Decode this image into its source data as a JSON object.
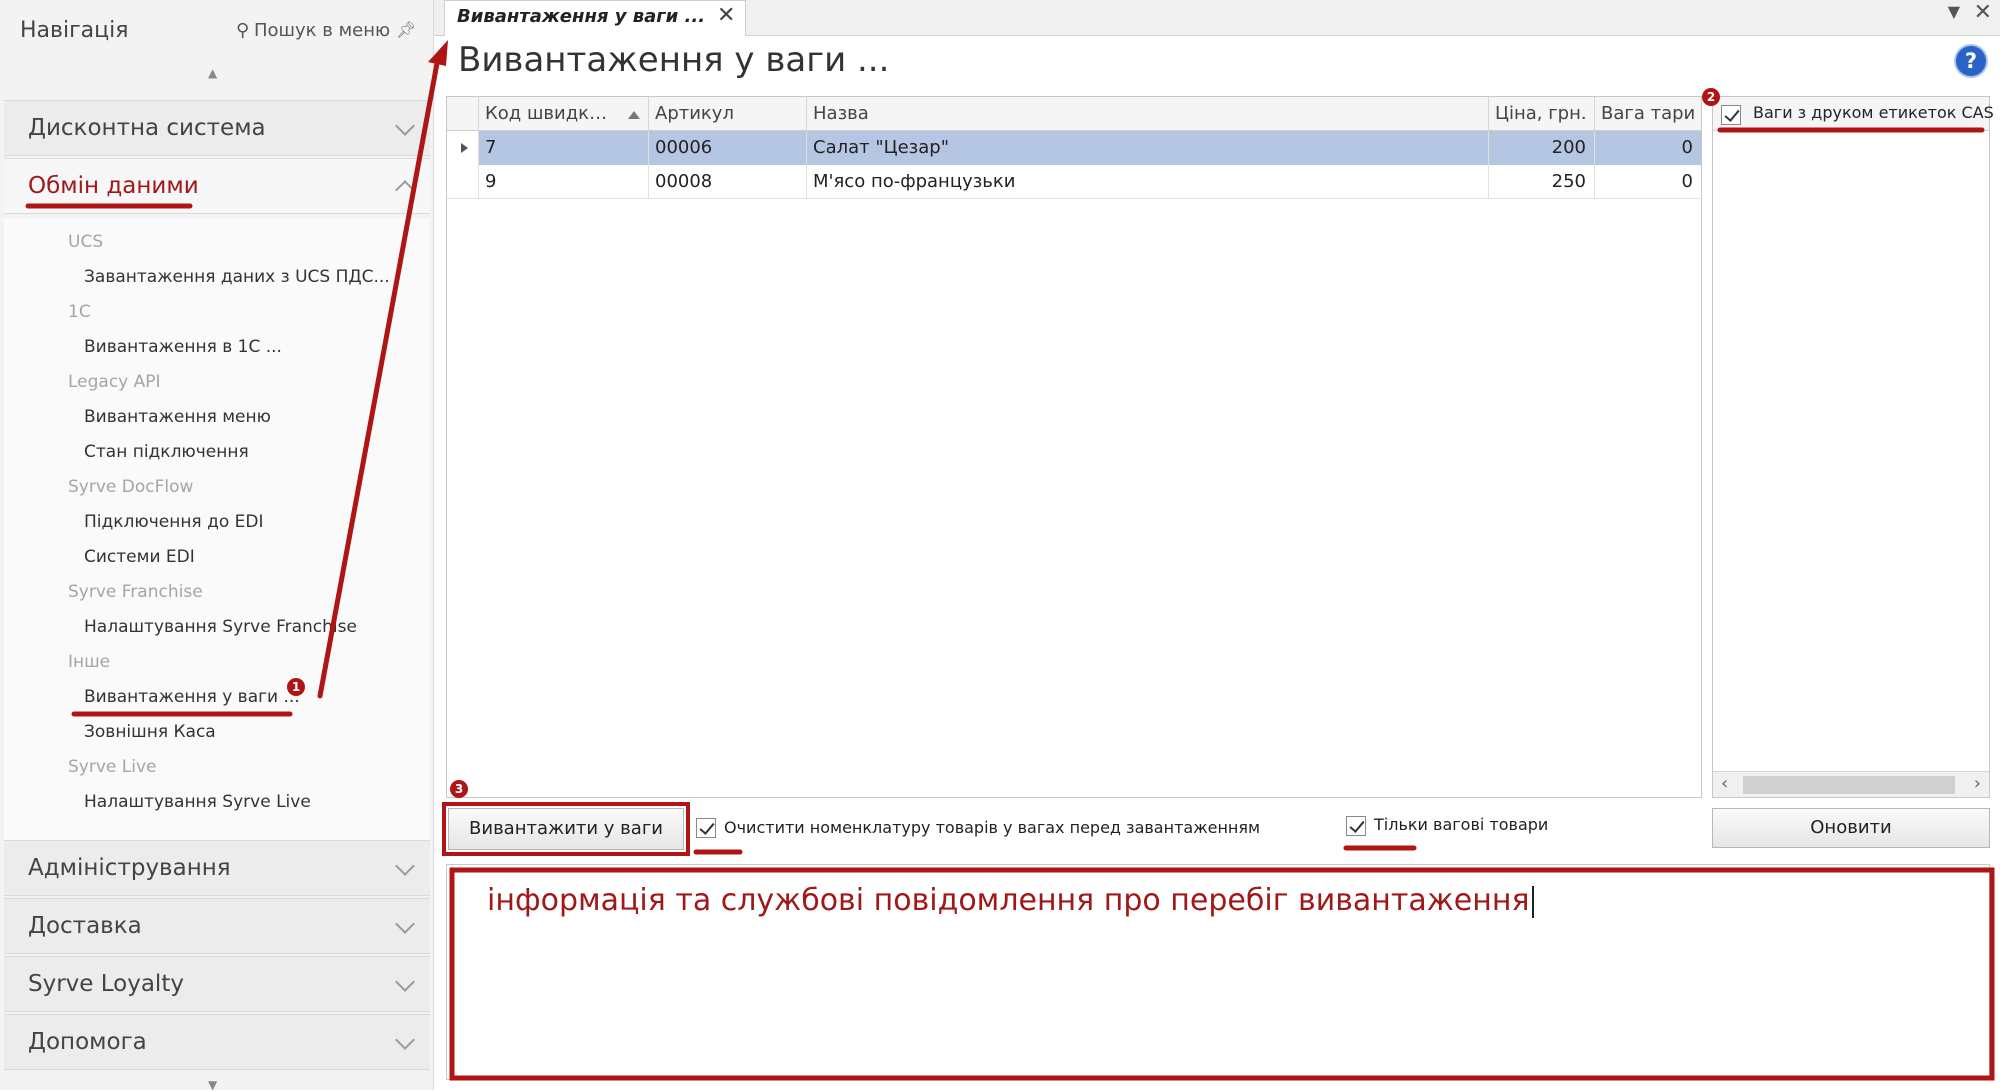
{
  "nav": {
    "title": "Навігація",
    "search_label": "Пошук в меню",
    "sections_top": [
      {
        "label": "Дисконтна система"
      },
      {
        "label": "Обмін даними"
      }
    ],
    "exchange_items": [
      {
        "kind": "group",
        "label": "UCS"
      },
      {
        "kind": "item",
        "label": "Завантаження даних з UCS ПДС..."
      },
      {
        "kind": "group",
        "label": "1С"
      },
      {
        "kind": "item",
        "label": "Вивантаження в 1С ..."
      },
      {
        "kind": "group",
        "label": "Legacy API"
      },
      {
        "kind": "item",
        "label": "Вивантаження меню"
      },
      {
        "kind": "item",
        "label": "Стан підключення"
      },
      {
        "kind": "group",
        "label": "Syrve DocFlow"
      },
      {
        "kind": "item",
        "label": "Підключення до EDI"
      },
      {
        "kind": "item",
        "label": "Системи EDI"
      },
      {
        "kind": "group",
        "label": "Syrve Franchise"
      },
      {
        "kind": "item",
        "label": "Налаштування Syrve Franchise"
      },
      {
        "kind": "group",
        "label": "Інше"
      },
      {
        "kind": "item",
        "label": "Вивантаження у ваги ..."
      },
      {
        "kind": "item",
        "label": "Зовнішня Каса"
      },
      {
        "kind": "group",
        "label": "Syrve Live"
      },
      {
        "kind": "item",
        "label": "Налаштування Syrve Live"
      }
    ],
    "sections_bottom": [
      {
        "label": "Адміністрування"
      },
      {
        "label": "Доставка"
      },
      {
        "label": "Syrve Loyalty"
      },
      {
        "label": "Допомога"
      }
    ]
  },
  "tab": {
    "label": "Вивантаження у ваги ..."
  },
  "page": {
    "title": "Вивантаження у ваги ..."
  },
  "grid": {
    "columns": [
      "Код швидкого набору",
      "Артикул",
      "Назва",
      "Ціна, грн.",
      "Вага тари"
    ],
    "rows": [
      {
        "code": "7",
        "article": "00006",
        "name": "Салат \"Цезар\"",
        "price": "200",
        "tare": "0",
        "selected": true
      },
      {
        "code": "9",
        "article": "00008",
        "name": "М'ясо по-французьки",
        "price": "250",
        "tare": "0",
        "selected": false
      }
    ]
  },
  "scales": {
    "label": "Ваги з друком етикеток CAS",
    "checked": true
  },
  "toolbar": {
    "export_label": "Вивантажити у ваги",
    "clear_label": "Очистити номенклатуру товарів у вагах перед завантаженням",
    "clear_checked": true,
    "weight_only_label": "Тільки вагові товари",
    "weight_only_checked": true,
    "refresh_label": "Оновити"
  },
  "log": {
    "text": "інформація та службові повідомлення про перебіг вивантаження"
  },
  "annotations": {
    "badge1": "1",
    "badge2": "2",
    "badge3": "3"
  },
  "colors": {
    "annotation": "#b01515",
    "selected_row": "#b5c6e2",
    "help": "#2a63c6"
  }
}
